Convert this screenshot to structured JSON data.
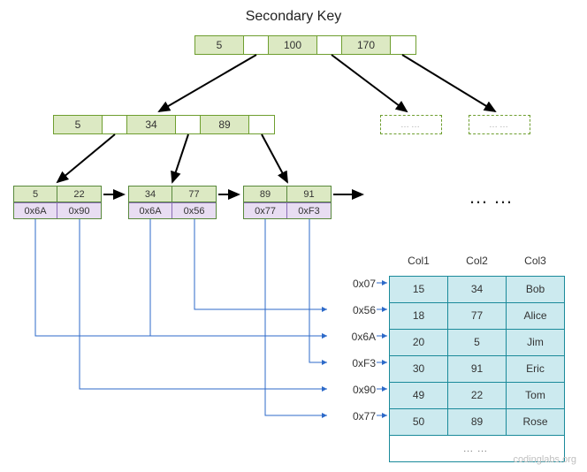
{
  "title": "Secondary Key",
  "watermark": "codinglabs.org",
  "root": {
    "k1": "5",
    "k2": "100",
    "k3": "170"
  },
  "internal": {
    "k1": "5",
    "k2": "34",
    "k3": "89"
  },
  "dashed1_label": "……",
  "dashed2_label": "……",
  "leaf1": {
    "k1": "5",
    "k2": "22",
    "p1": "0x6A",
    "p2": "0x90"
  },
  "leaf2": {
    "k1": "34",
    "k2": "77",
    "p1": "0x6A",
    "p2": "0x56"
  },
  "leaf3": {
    "k1": "89",
    "k2": "91",
    "p1": "0x77",
    "p2": "0xF3"
  },
  "big_ellipsis": "……",
  "addrs": {
    "a1": "0x07",
    "a2": "0x56",
    "a3": "0x6A",
    "a4": "0xF3",
    "a5": "0x90",
    "a6": "0x77"
  },
  "table": {
    "headers": {
      "c1": "Col1",
      "c2": "Col2",
      "c3": "Col3"
    },
    "rows": [
      {
        "c1": "15",
        "c2": "34",
        "c3": "Bob"
      },
      {
        "c1": "18",
        "c2": "77",
        "c3": "Alice"
      },
      {
        "c1": "20",
        "c2": "5",
        "c3": "Jim"
      },
      {
        "c1": "30",
        "c2": "91",
        "c3": "Eric"
      },
      {
        "c1": "49",
        "c2": "22",
        "c3": "Tom"
      },
      {
        "c1": "50",
        "c2": "89",
        "c3": "Rose"
      }
    ],
    "more": "……"
  }
}
